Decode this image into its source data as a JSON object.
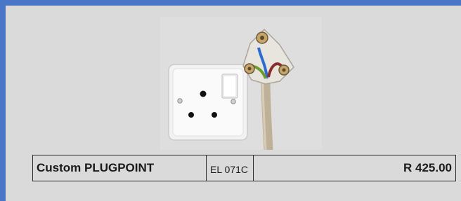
{
  "product": {
    "name": "Custom PLUGPOINT",
    "code": "EL 071C",
    "price": "R 425.00",
    "image_icon": "plugpoint-photo-icon"
  },
  "colors": {
    "border": "#4a76c8",
    "background": "#dadada",
    "text": "#1a1a1a"
  }
}
